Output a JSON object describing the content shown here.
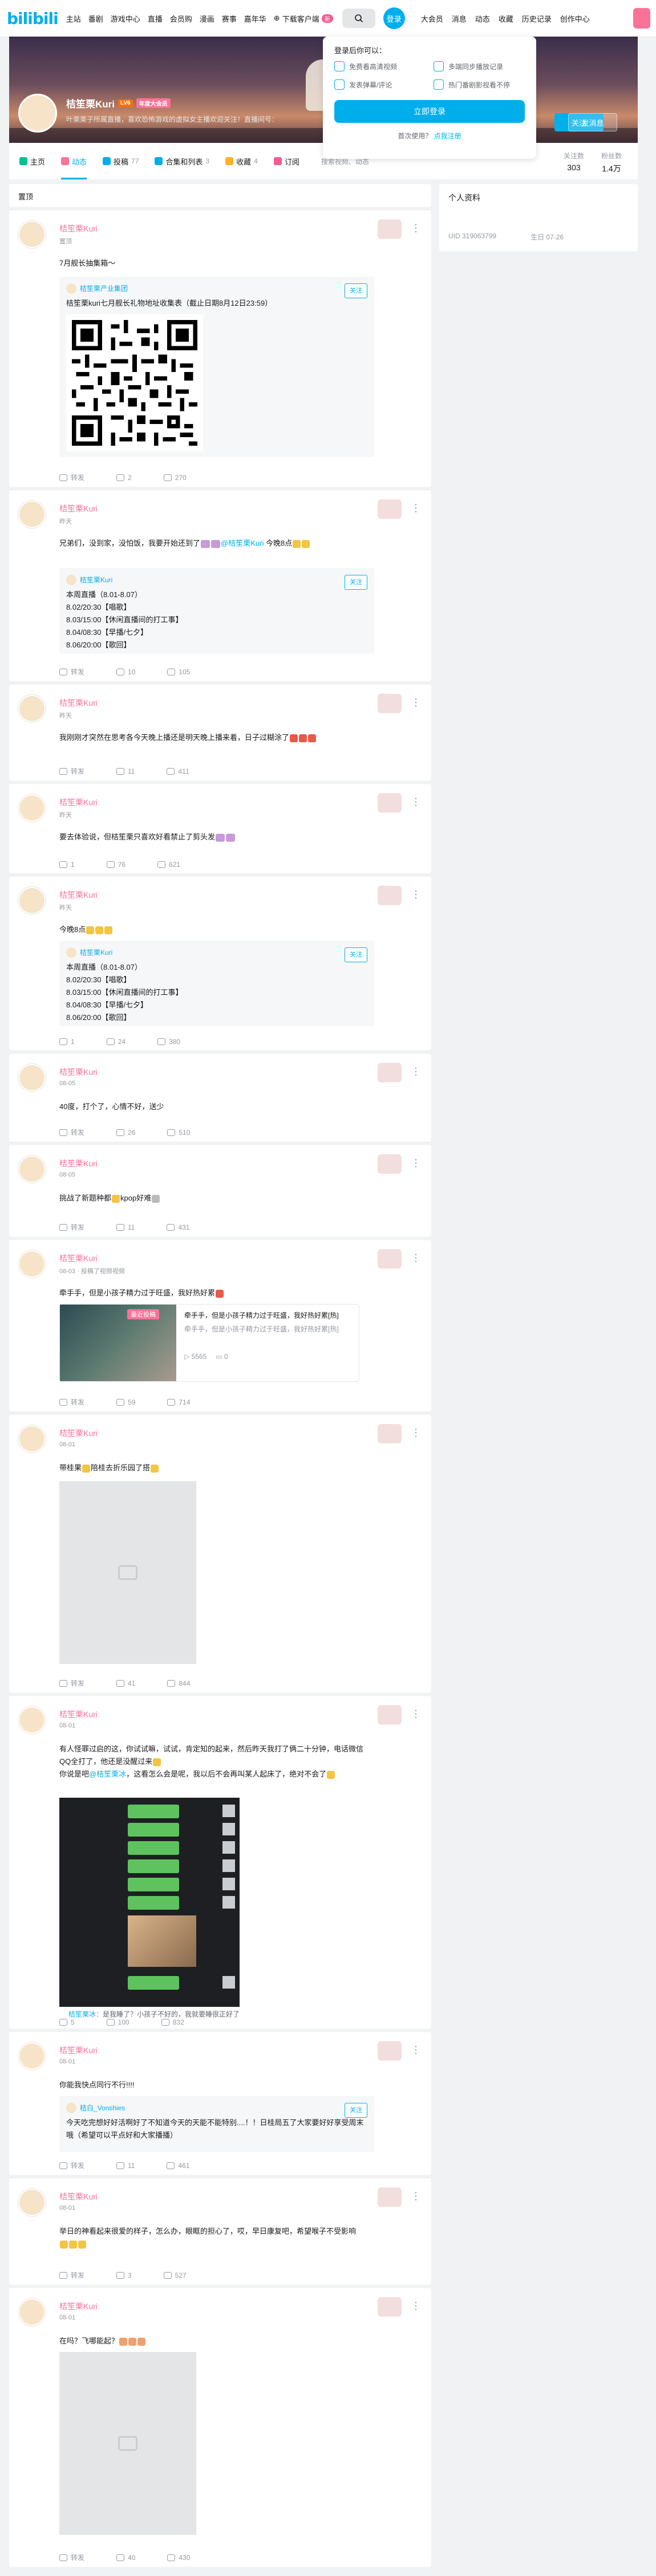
{
  "nav": {
    "logo": "bilibili",
    "items": [
      "主站",
      "番剧",
      "游戏中心",
      "直播",
      "会员购",
      "漫画",
      "赛事",
      "嘉年华"
    ],
    "download": "下载客户端",
    "download_badge": "新",
    "login": "登录",
    "right_items": [
      "大会员",
      "消息",
      "动态",
      "收藏",
      "历史记录",
      "创作中心"
    ]
  },
  "popup": {
    "title": "登录后你可以：",
    "benefits": [
      "免费看高清视频",
      "多端同步播放记录",
      "发表弹幕/评论",
      "热门番剧影视看不停"
    ],
    "button": "立即登录",
    "first_use_prefix": "首次使用？",
    "register": "点我注册"
  },
  "profile": {
    "name": "桔笙栗Kuri",
    "level": "LV6",
    "vip": "年度大会员",
    "sign": "叶栗栗子所属直播，喜欢恐怖游戏的虚拟女主播欢迎关注！直播间号：",
    "follow": "关注",
    "message": "发消息"
  },
  "tabs": [
    {
      "label": "主页",
      "count": ""
    },
    {
      "label": "动态",
      "count": ""
    },
    {
      "label": "投稿",
      "count": "77"
    },
    {
      "label": "合集和列表",
      "count": "3"
    },
    {
      "label": "收藏",
      "count": "4"
    },
    {
      "label": "订阅",
      "count": ""
    }
  ],
  "tab_search": "搜索视频、动态",
  "stats": [
    {
      "label": "关注数",
      "value": "303"
    },
    {
      "label": "粉丝数",
      "value": "1.4万"
    }
  ],
  "feed_head": "置顶",
  "side": {
    "title": "个人资料",
    "uid": "UID  319063799",
    "birthday": "生日  07-26"
  },
  "posts": [
    {
      "name": "桔笙栗Kuri",
      "time": "置顶",
      "text": "7月舰长抽集箱～",
      "quote_user": "桔笙栗产业集团",
      "quote_text": "桔笙栗kuri七月舰长礼物地址收集表（截止日期8月12日23:59）",
      "follow": "关注",
      "share": "转发",
      "comment": "2",
      "like": "270"
    },
    {
      "name": "桔笙栗Kuri",
      "time": "昨天",
      "text": "兄弟们，没到家，没怕饭，我要开始还到了",
      "at": "@桔笙栗Kuri",
      "text2": "今晚8点",
      "quote_user": "桔笙栗Kuri",
      "schedule_title": "本周直播（8.01-8.07）",
      "schedule": [
        "8.02/20:30【唱歌】",
        "8.03/15:00【休闲直播间的打工事】",
        "8.04/08:30【早播/七夕】",
        "8.06/20:00【歌回】"
      ],
      "follow": "关注",
      "share": "转发",
      "comment": "10",
      "like": "105"
    },
    {
      "name": "桔笙栗Kuri",
      "time": "昨天",
      "text": "我刚刚才突然在思考各今天晚上播还是明天晚上播来着，日子过糊涂了",
      "share": "转发",
      "comment": "11",
      "like": "411"
    },
    {
      "name": "桔笙栗Kuri",
      "time": "昨天",
      "text": "要去体验说，但桔笙栗只喜欢好看禁止了剪头发",
      "share": "1",
      "comment": "76",
      "like": "621"
    },
    {
      "name": "桔笙栗Kuri",
      "time": "昨天",
      "text": "今晚8点",
      "quote_user": "桔笙栗Kuri",
      "schedule_title": "本周直播（8.01-8.07）",
      "schedule": [
        "8.02/20:30【唱歌】",
        "8.03/15:00【休闲直播间的打工事】",
        "8.04/08:30【早播/七夕】",
        "8.06/20:00【歌回】"
      ],
      "follow": "关注",
      "share": "1",
      "comment": "24",
      "like": "380"
    },
    {
      "name": "桔笙栗Kuri",
      "time": "08-05",
      "text": "40度，打个了，心情不好，送少",
      "share": "转发",
      "comment": "26",
      "like": "510"
    },
    {
      "name": "桔笙栗Kuri",
      "time": "08-05",
      "text": "挑战了新题种都",
      "text2": "kpop好难",
      "share": "转发",
      "comment": "11",
      "like": "431"
    },
    {
      "name": "桔笙栗Kuri",
      "time": "08-03 · 投稿了视频视频",
      "text": "牵手手，但是小孩子精力过于旺盛，我好热好累",
      "video_badge": "最近投稿",
      "video_title": "牵手手，但是小孩子精力过于旺盛，我好热好累[热]",
      "video_desc": "牵手手，但是小孩子精力过于旺盛，我好热好累[热]",
      "video_views": "5565",
      "video_danmaku": "0",
      "share": "转发",
      "comment": "59",
      "like": "714"
    },
    {
      "name": "桔笙栗Kuri",
      "time": "08-01",
      "text": "带桂果",
      "text2": "陪桂去折乐园了搭",
      "share": "转发",
      "comment": "41",
      "like": "844"
    },
    {
      "name": "桔笙栗Kuri",
      "time": "08-01",
      "text": "有人怪罪过启的这，你试试嘛，试试，肯定知的起来，然后昨天我打了俩二十分钟，电话微信QQ全打了，他还是没醒过来",
      "text_b": "你说是吧",
      "at": "@桔笙栗冰",
      "text_c": "，这看怎么会是呢，我以后不会再叫某人起床了，绝对不会了",
      "hot_user": "桔笙栗冰：",
      "hot_text": "是我睡了？小孩子不好的，我就要睡很正好了",
      "share": "5",
      "comment": "100",
      "like": "832"
    },
    {
      "name": "桔笙栗Kuri",
      "time": "08-01",
      "text": "你能我快点同行不行!!!!",
      "quote_user": "桔白_Vonshies",
      "quote_text": "今天吃完想好好活啊好了不知道今天的天能不能特别....！！日桂局五了大家要好好享受周末哦（希望可以平点好和大家播播）",
      "follow": "关注",
      "share": "转发",
      "comment": "11",
      "like": "461"
    },
    {
      "name": "桔笙栗Kuri",
      "time": "08-01",
      "text": "举日的神看起来很爱的样子，怎么办，眼眶的担心了，哎，早日康复吧，希望喉子不受影响",
      "share": "转发",
      "comment": "3",
      "like": "527"
    },
    {
      "name": "桔笙栗Kuri",
      "time": "08-01",
      "text": "在吗？飞哪能起？",
      "share": "转发",
      "comment": "40",
      "like": "430"
    }
  ]
}
